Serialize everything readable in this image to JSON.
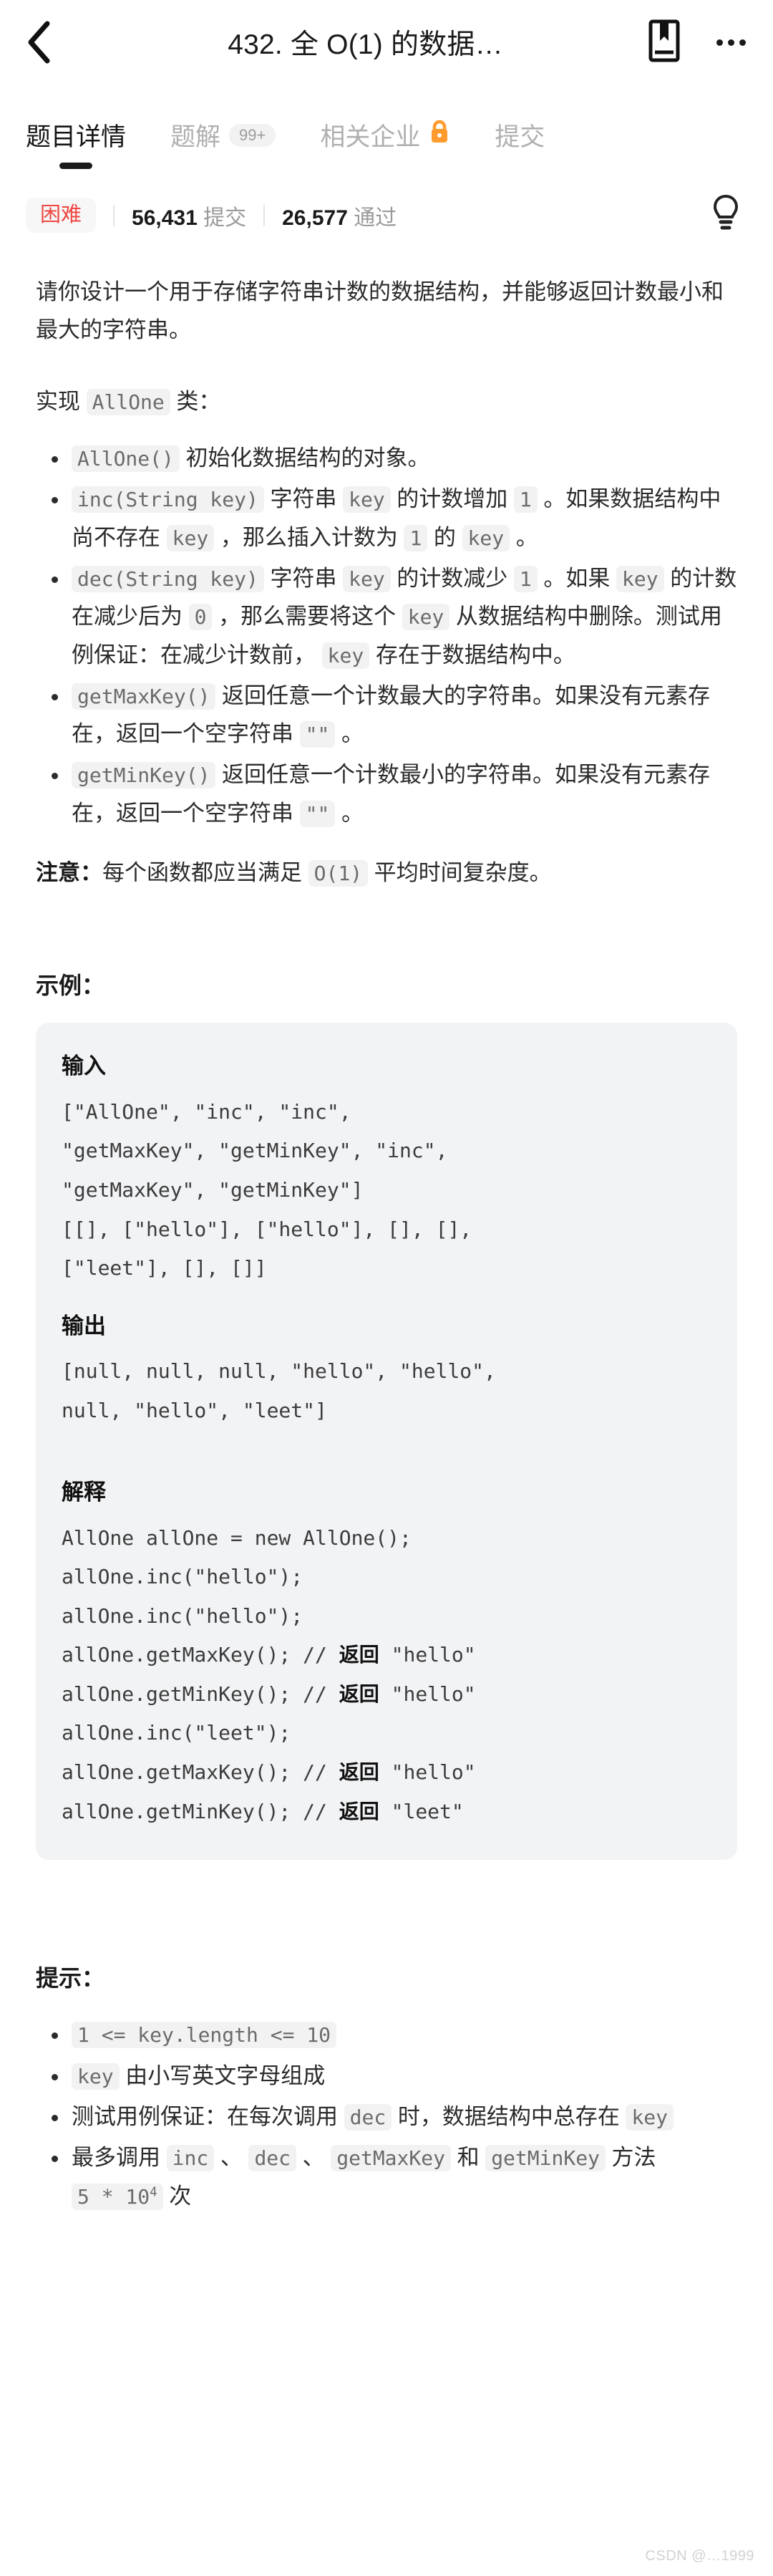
{
  "header": {
    "title": "432. 全 O(1) 的数据…",
    "back_icon": "back-chevron-icon",
    "bookmark_icon": "bookmark-icon",
    "more_icon": "more-options-icon"
  },
  "tabs": [
    {
      "label": "题目详情",
      "active": true
    },
    {
      "label": "题解",
      "badge": "99+",
      "active": false
    },
    {
      "label": "相关企业",
      "lock": true,
      "active": false
    },
    {
      "label": "提交",
      "active": false
    }
  ],
  "stats": {
    "difficulty": "困难",
    "difficulty_color": "#ef4743",
    "submissions_value": "56,431",
    "submissions_label": "提交",
    "accepted_value": "26,577",
    "accepted_label": "通过",
    "hint_icon": "lightbulb-icon"
  },
  "description": {
    "intro": "请你设计一个用于存储字符串计数的数据结构，并能够返回计数最小和最大的字符串。",
    "implement_prefix": "实现",
    "implement_class": "AllOne",
    "implement_suffix": "类：",
    "methods": [
      {
        "code": "AllOne()",
        "text": " 初始化数据结构的对象。"
      },
      {
        "code": "inc(String key)",
        "text_1": " 字符串 ",
        "code_2": "key",
        "text_2": " 的计数增加 ",
        "code_3": "1",
        "text_3": " 。如果数据结构中尚不存在 ",
        "code_4": "key",
        "text_4": " ，那么插入计数为 ",
        "code_5": "1",
        "text_5": " 的 ",
        "code_6": "key",
        "text_6": " 。"
      },
      {
        "code": "dec(String key)",
        "text_1": " 字符串 ",
        "code_2": "key",
        "text_2": " 的计数减少 ",
        "code_3": "1",
        "text_3": " 。如果 ",
        "code_4": "key",
        "text_4": " 的计数在减少后为 ",
        "code_5": "0",
        "text_5": " ，那么需要将这个 ",
        "code_6": "key",
        "text_6": " 从数据结构中删除。测试用例保证：在减少计数前， ",
        "code_7": "key",
        "text_7": " 存在于数据结构中。"
      },
      {
        "code": "getMaxKey()",
        "text_1": " 返回任意一个计数最大的字符串。如果没有元素存在，返回一个空字符串 ",
        "code_2": "\"\"",
        "text_2": " 。"
      },
      {
        "code": "getMinKey()",
        "text_1": " 返回任意一个计数最小的字符串。如果没有元素存在，返回一个空字符串 ",
        "code_2": "\"\"",
        "text_2": " 。"
      }
    ],
    "note_label": "注意：",
    "note_text_1": "每个函数都应当满足 ",
    "note_code": "O(1)",
    "note_text_2": " 平均时间复杂度。"
  },
  "example": {
    "heading": "示例：",
    "input_label": "输入",
    "input_line_1": "[\"AllOne\", \"inc\", \"inc\",",
    "input_line_2": "\"getMaxKey\", \"getMinKey\", \"inc\",",
    "input_line_3": "\"getMaxKey\", \"getMinKey\"]",
    "input_line_4": "[[], [\"hello\"], [\"hello\"], [], [],",
    "input_line_5": "[\"leet\"], [], []]",
    "output_label": "输出",
    "output_line_1": "[null, null, null, \"hello\", \"hello\",",
    "output_line_2": "null, \"hello\", \"leet\"]",
    "explain_label": "解释",
    "explain_lines": [
      {
        "code": "AllOne allOne = new AllOne();",
        "comment": "",
        "ret": "",
        "val": ""
      },
      {
        "code": "allOne.inc(\"hello\");",
        "comment": "",
        "ret": "",
        "val": ""
      },
      {
        "code": "allOne.inc(\"hello\");",
        "comment": "",
        "ret": "",
        "val": ""
      },
      {
        "code": "allOne.getMaxKey(); // ",
        "comment": "",
        "ret": "返回",
        "val": " \"hello\""
      },
      {
        "code": "allOne.getMinKey(); // ",
        "comment": "",
        "ret": "返回",
        "val": " \"hello\""
      },
      {
        "code": "allOne.inc(\"leet\");",
        "comment": "",
        "ret": "",
        "val": ""
      },
      {
        "code": "allOne.getMaxKey(); // ",
        "comment": "",
        "ret": "返回",
        "val": " \"hello\""
      },
      {
        "code": "allOne.getMinKey(); // ",
        "comment": "",
        "ret": "返回",
        "val": " \"leet\""
      }
    ]
  },
  "hints": {
    "heading": "提示：",
    "items": [
      {
        "code_1": "1 <= key.length <= 10"
      },
      {
        "code_1": "key",
        "text_1": " 由小写英文字母组成"
      },
      {
        "text_0": "测试用例保证：在每次调用 ",
        "code_1": "dec",
        "text_1": " 时，数据结构中总存在 ",
        "code_2": "key"
      },
      {
        "text_0": "最多调用 ",
        "code_1": "inc",
        "text_1": " 、 ",
        "code_2": "dec",
        "text_2": " 、 ",
        "code_3": "getMaxKey",
        "text_3": " 和 ",
        "code_4": "getMinKey",
        "text_4": " 方法 ",
        "code_5_base": "5 * 10",
        "code_5_sup": "4",
        "text_5": " 次"
      }
    ]
  },
  "watermark": "CSDN @…1999"
}
